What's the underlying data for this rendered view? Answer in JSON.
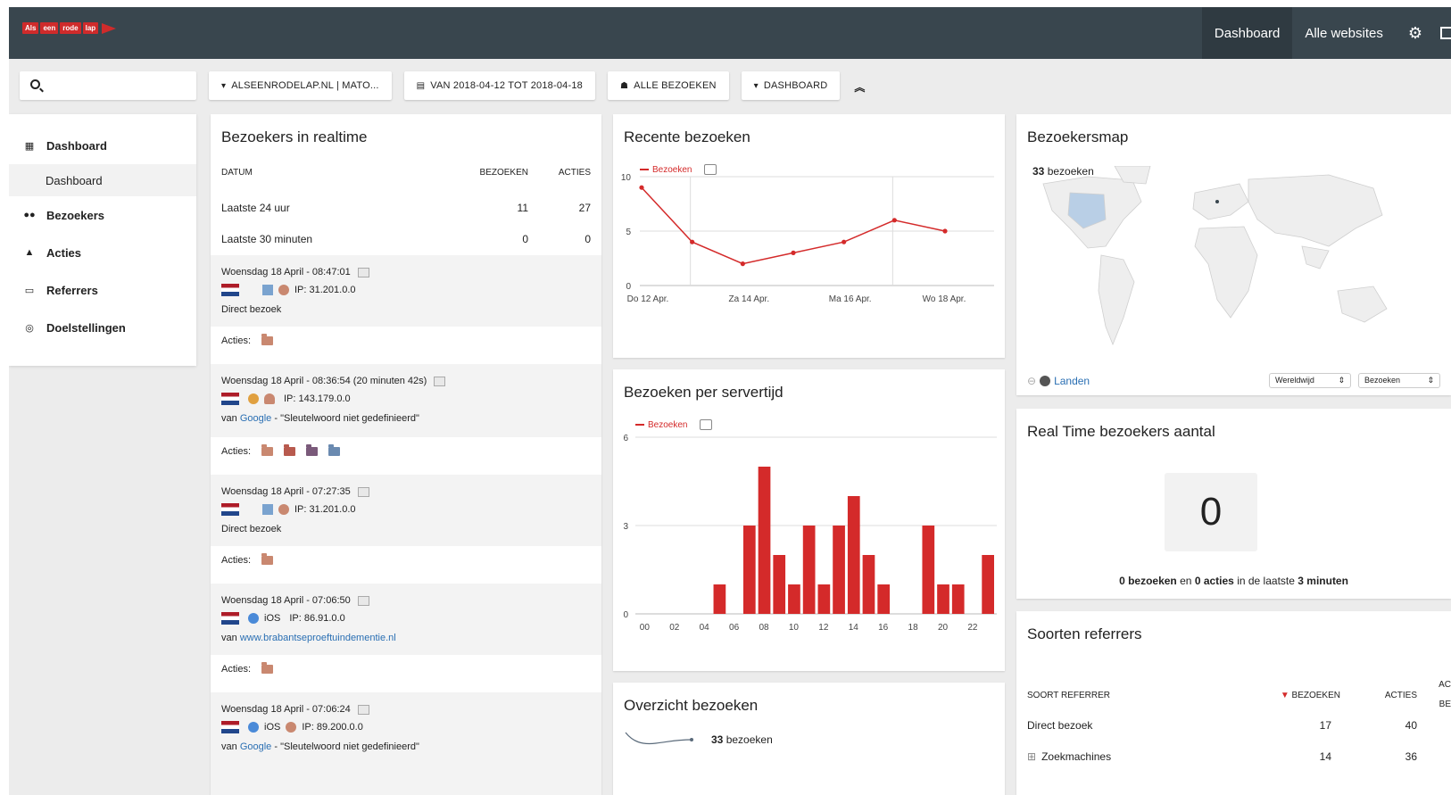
{
  "topbar": {
    "logo_tiles": [
      "Als",
      "een",
      "rode",
      "lap"
    ],
    "nav": [
      "Dashboard",
      "Alle websites"
    ],
    "settings_icon": "gear-icon",
    "accent": "#39464e"
  },
  "toolbar": {
    "site": "ALSEENRODELAP.NL | MATO...",
    "period": "VAN 2018-04-12 TOT 2018-04-18",
    "segment": "ALLE BEZOEKEN",
    "dashboard": "DASHBOARD"
  },
  "sidebar": {
    "dashboard": "Dashboard",
    "dashboard_sub": "Dashboard",
    "visitors": "Bezoekers",
    "actions": "Acties",
    "referrers": "Referrers",
    "goals": "Doelstellingen"
  },
  "realtime": {
    "title": "Bezoekers in realtime",
    "headers": [
      "DATUM",
      "BEZOEKEN",
      "ACTIES"
    ],
    "rows": [
      {
        "label": "Laatste 24 uur",
        "visits": "11",
        "actions": "27"
      },
      {
        "label": "Laatste 30 minuten",
        "visits": "0",
        "actions": "0"
      }
    ],
    "actions_label": "Acties:",
    "visits": [
      {
        "date": "Woensdag 18 April - 08:47:01",
        "ip": "IP: 31.201.0.0",
        "source": "Direct bezoek"
      },
      {
        "date": "Woensdag 18 April - 08:36:54 (20 minuten 42s)",
        "ip": "IP: 143.179.0.0",
        "src_prefix": "van",
        "src_link": "Google",
        "src_suffix": "- \"Sleutelwoord niet gedefinieerd\""
      },
      {
        "date": "Woensdag 18 April - 07:27:35",
        "ip": "IP: 31.201.0.0",
        "source": "Direct bezoek"
      },
      {
        "date": "Woensdag 18 April - 07:06:50",
        "os": "iOS",
        "ip": "IP: 86.91.0.0",
        "src_prefix": "van",
        "src_link": "www.brabantseproeftuindementie.nl"
      },
      {
        "date": "Woensdag 18 April - 07:06:24",
        "os": "iOS",
        "ip": "IP: 89.200.0.0",
        "src_prefix": "van",
        "src_link": "Google",
        "src_suffix": "- \"Sleutelwoord niet gedefinieerd\""
      }
    ]
  },
  "recent": {
    "title": "Recente bezoeken",
    "legend": "Bezoeken"
  },
  "server": {
    "title": "Bezoeken per servertijd",
    "legend": "Bezoeken"
  },
  "overview": {
    "title": "Overzicht bezoeken",
    "count": "33",
    "count_label": "bezoeken"
  },
  "map": {
    "title": "Bezoekersmap",
    "count": "33",
    "count_label": "bezoeken",
    "countries_link": "Landen",
    "region_select": "Wereldwijd",
    "metric_select": "Bezoeken"
  },
  "rt_count": {
    "title": "Real Time bezoekers aantal",
    "value": "0",
    "s1": "0 bezoeken",
    "s2": "en",
    "s3": "0 acties",
    "s4": "in de laatste",
    "s5": "3 minuten"
  },
  "referrers": {
    "title": "Soorten referrers",
    "headers": [
      "SOORT REFERRER",
      "BEZOEKEN",
      "ACTIES",
      "AC",
      "BE"
    ],
    "rows": [
      {
        "label": "Direct bezoek",
        "visits": "17",
        "actions": "40"
      },
      {
        "label": "Zoekmachines",
        "visits": "14",
        "actions": "36"
      }
    ]
  },
  "chart_data": [
    {
      "type": "line",
      "title": "Recente bezoeken",
      "series": [
        {
          "name": "Bezoeken",
          "values": [
            9,
            4,
            2,
            3,
            4,
            6,
            5
          ]
        }
      ],
      "x": [
        "2018-04-12",
        "2018-04-13",
        "2018-04-14",
        "2018-04-15",
        "2018-04-16",
        "2018-04-17",
        "2018-04-18"
      ],
      "x_tick_labels": [
        "Do 12 Apr.",
        "Za 14 Apr.",
        "Ma 16 Apr.",
        "Wo 18 Apr."
      ],
      "y_ticks": [
        0,
        5,
        10
      ],
      "ylim": [
        0,
        10
      ],
      "color": "#d42a2a"
    },
    {
      "type": "bar",
      "title": "Bezoeken per servertijd",
      "series": [
        {
          "name": "Bezoeken",
          "values": [
            0,
            0,
            0,
            0,
            0,
            1,
            0,
            3,
            5,
            2,
            1,
            3,
            1,
            3,
            4,
            2,
            1,
            0,
            0,
            3,
            1,
            1,
            0,
            2
          ]
        }
      ],
      "categories": [
        "00",
        "01",
        "02",
        "03",
        "04",
        "05",
        "06",
        "07",
        "08",
        "09",
        "10",
        "11",
        "12",
        "13",
        "14",
        "15",
        "16",
        "17",
        "18",
        "19",
        "20",
        "21",
        "22",
        "23"
      ],
      "x_tick_labels": [
        "00",
        "02",
        "04",
        "06",
        "08",
        "10",
        "12",
        "14",
        "16",
        "18",
        "20",
        "22"
      ],
      "y_ticks": [
        0,
        3,
        6
      ],
      "ylim": [
        0,
        6
      ],
      "color": "#d42a2a"
    }
  ]
}
